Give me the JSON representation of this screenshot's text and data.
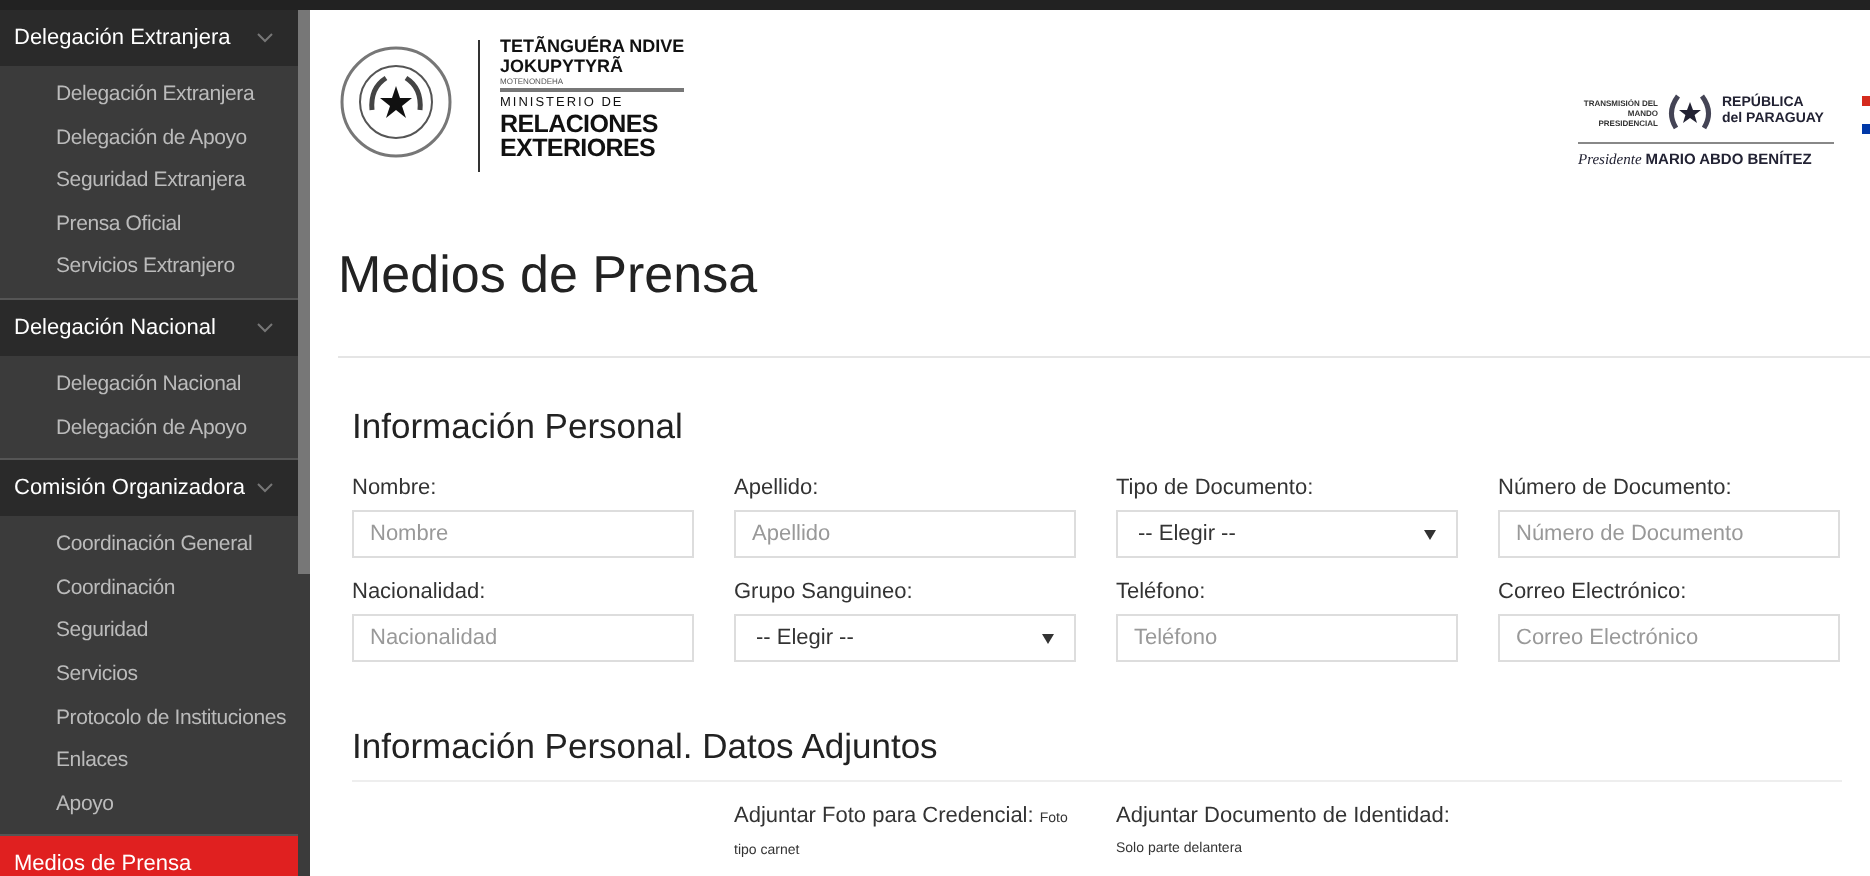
{
  "sidebar": {
    "groups": [
      {
        "title": "Delegación Extranjera",
        "selected": false,
        "expanded": true,
        "items": [
          {
            "label": "Delegación Extranjera",
            "selected": false
          },
          {
            "label": "Delegación de Apoyo",
            "selected": false
          },
          {
            "label": "Seguridad Extranjera",
            "selected": false
          },
          {
            "label": "Prensa Oficial",
            "selected": false
          },
          {
            "label": "Servicios Extranjero",
            "selected": false
          }
        ]
      },
      {
        "title": "Delegación Nacional",
        "selected": false,
        "expanded": true,
        "items": [
          {
            "label": "Delegación Nacional",
            "selected": false
          },
          {
            "label": "Delegación de Apoyo",
            "selected": false
          }
        ]
      },
      {
        "title": "Comisión Organizadora",
        "selected": false,
        "expanded": true,
        "items": [
          {
            "label": "Coordinación General",
            "selected": false
          },
          {
            "label": "Coordinación",
            "selected": false
          },
          {
            "label": "Seguridad",
            "selected": false
          },
          {
            "label": "Servicios",
            "selected": false
          },
          {
            "label": "Protocolo de Instituciones",
            "selected": false
          },
          {
            "label": "Enlaces",
            "selected": false
          },
          {
            "label": "Apoyo",
            "selected": false
          }
        ]
      },
      {
        "title": "Medios de Prensa",
        "selected": true,
        "expanded": false
      }
    ]
  },
  "header": {
    "ministry_logo": {
      "line_1": "TETÃNGUÉRA NDIVE",
      "line_2": "JOKUPYTYRÃ",
      "line_3": "MOTENONDEHA",
      "line_4": "MINISTERIO DE",
      "line_5": "RELACIONES",
      "line_6": "EXTERIORES"
    },
    "presidency_logo": {
      "left_text": "TRANSMISIÓN DEL MANDO PRESIDENCIAL",
      "country_line_1": "REPÚBLICA",
      "country_line_2": "del PARAGUAY",
      "president_label": "Presidente",
      "president_name": "MARIO ABDO BENÍTEZ"
    }
  },
  "page_title": "Medios de Prensa",
  "personal_section": {
    "title": "Información Personal",
    "fields": [
      {
        "label": "Nombre:",
        "kind": "text",
        "placeholder": "Nombre"
      },
      {
        "label": "Apellido:",
        "kind": "text",
        "placeholder": "Apellido"
      },
      {
        "label": "Tipo de Documento:",
        "kind": "select",
        "value": "-- Elegir --"
      },
      {
        "label": "Número de Documento:",
        "kind": "text",
        "placeholder": "Número de Documento"
      },
      {
        "label": "Nacionalidad:",
        "kind": "text",
        "placeholder": "Nacionalidad"
      },
      {
        "label": "Grupo Sanguineo:",
        "kind": "select",
        "value": "-- Elegir --"
      },
      {
        "label": "Teléfono:",
        "kind": "text",
        "placeholder": "Teléfono"
      },
      {
        "label": "Correo Electrónico:",
        "kind": "text",
        "placeholder": "Correo Electrónico"
      }
    ]
  },
  "attachments_section": {
    "title": "Información Personal. Datos Adjuntos",
    "items": [
      {
        "label": "Adjuntar Foto para Credencial:",
        "note": "Foto tipo carnet"
      },
      {
        "label": "Adjuntar Documento de Identidad:",
        "note": "Solo parte delantera"
      }
    ]
  }
}
